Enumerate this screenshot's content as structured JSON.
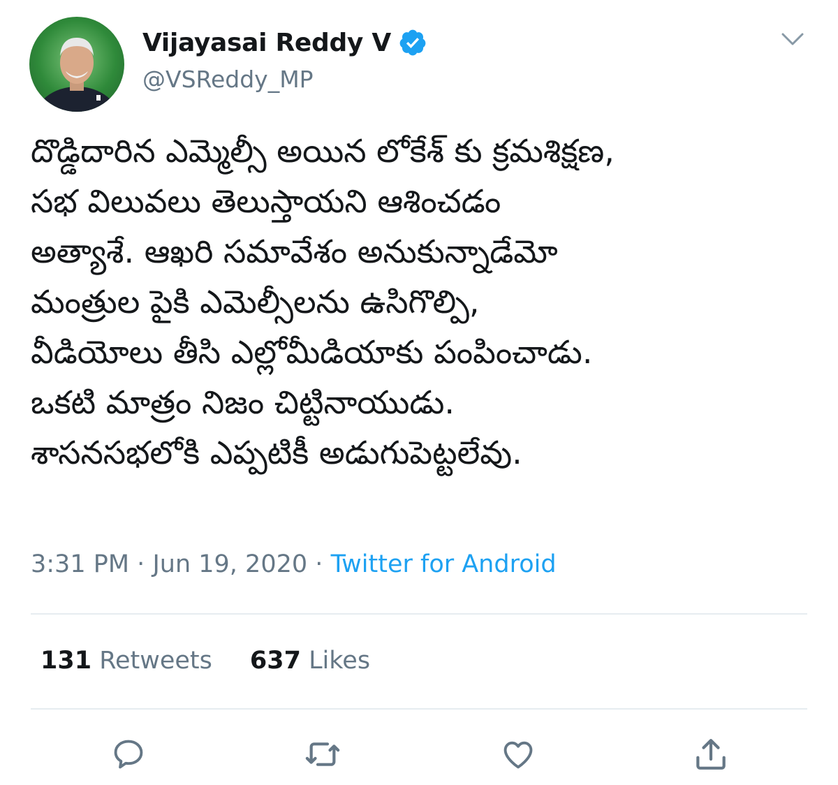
{
  "author": {
    "name": "Vijayasai Reddy V",
    "handle": "@VSReddy_MP",
    "avatar_icon": "profile-photo",
    "verified_icon": "verified-badge-icon"
  },
  "tweet": {
    "lines": [
      "దొడ్డిదారిన ఎమ్మెల్సీ అయిన లోకేశ్ కు క్రమశిక్షణ,",
      "సభ విలువలు తెలుస్తాయని ఆశించడం",
      "అత్యాశే. ఆఖరి సమావేశం అనుకున్నాడేమో",
      "మంత్రుల పైకి ఎమెల్సీలను ఉసిగొల్పి,",
      "వీడియోలు తీసి ఎల్లోమీడియాకు పంపించాడు.",
      "ఒకటి మాత్రం నిజం చిట్టినాయుడు.",
      "శాసనసభలోకి ఎప్పటికీ అడుగుపెట్టలేవు."
    ],
    "time": "3:31 PM",
    "date": "Jun 19, 2020",
    "separator": "·",
    "source": "Twitter for Android"
  },
  "stats": {
    "retweets_count": "131",
    "retweets_label": "Retweets",
    "likes_count": "637",
    "likes_label": "Likes"
  },
  "colors": {
    "accent": "#1da1f2",
    "muted": "#657786",
    "text": "#14171a",
    "divider": "#e6ecf0"
  },
  "actions": [
    "reply-icon",
    "retweet-icon",
    "like-icon",
    "share-icon"
  ]
}
